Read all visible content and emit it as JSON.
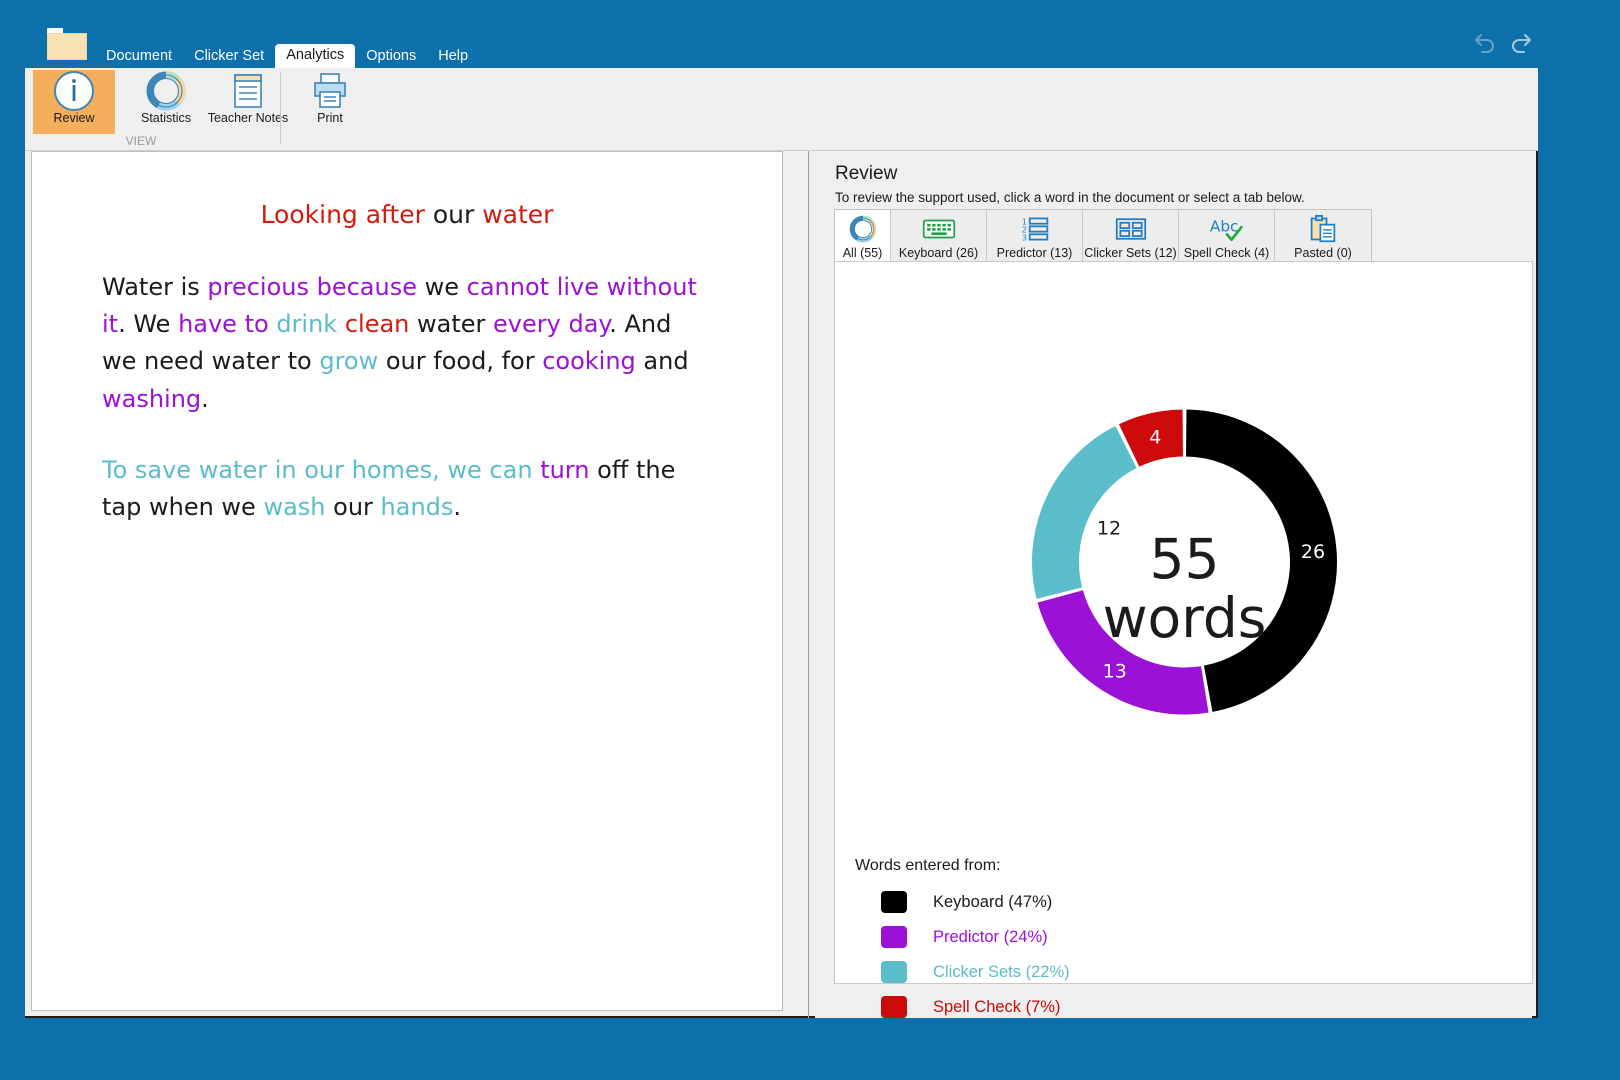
{
  "titlebar": {
    "folder_icon": "folder-icon",
    "menu": [
      {
        "label": "Document",
        "active": false
      },
      {
        "label": "Clicker Set",
        "active": false
      },
      {
        "label": "Analytics",
        "active": true
      },
      {
        "label": "Options",
        "active": false
      },
      {
        "label": "Help",
        "active": false
      }
    ],
    "undo_icon": "undo-arrow-icon",
    "redo_icon": "redo-arrow-icon"
  },
  "ribbon": {
    "group_label": "VIEW",
    "buttons": [
      {
        "label": "Review",
        "icon": "info-circle-icon",
        "selected": true
      },
      {
        "label": "Statistics",
        "icon": "donut-chart-icon",
        "selected": false
      },
      {
        "label": "Teacher Notes",
        "icon": "notes-document-icon",
        "selected": false
      },
      {
        "label": "Print",
        "icon": "printer-icon",
        "selected": false
      }
    ]
  },
  "document": {
    "title_runs": [
      {
        "text": "Looking after ",
        "color": "#d41a0f"
      },
      {
        "text": "our ",
        "color": "#1b1b1b"
      },
      {
        "text": "water",
        "color": "#d41a0f"
      }
    ],
    "paragraphs": [
      [
        {
          "text": "Water is ",
          "color": "#1b1b1b"
        },
        {
          "text": "precious because ",
          "color": "#9b11d6"
        },
        {
          "text": "we ",
          "color": "#1b1b1b"
        },
        {
          "text": "cannot live without it",
          "color": "#9b11d6"
        },
        {
          "text": ".  We ",
          "color": "#1b1b1b"
        },
        {
          "text": "have to ",
          "color": "#9b11d6"
        },
        {
          "text": "drink ",
          "color": "#5bbcca"
        },
        {
          "text": "clean ",
          "color": "#d41a0f"
        },
        {
          "text": "water ",
          "color": "#1b1b1b"
        },
        {
          "text": "every day",
          "color": "#9b11d6"
        },
        {
          "text": ". And we need water to ",
          "color": "#1b1b1b"
        },
        {
          "text": "grow ",
          "color": "#5bbcca"
        },
        {
          "text": "our food, for ",
          "color": "#1b1b1b"
        },
        {
          "text": "cooking ",
          "color": "#9b11d6"
        },
        {
          "text": "and ",
          "color": "#1b1b1b"
        },
        {
          "text": "washing",
          "color": "#9b11d6"
        },
        {
          "text": ".",
          "color": "#1b1b1b"
        }
      ],
      [
        {
          "text": "To save water in our homes, we can ",
          "color": "#5bbcca"
        },
        {
          "text": "turn ",
          "color": "#9b11d6"
        },
        {
          "text": "off the tap when we ",
          "color": "#1b1b1b"
        },
        {
          "text": "wash ",
          "color": "#5bbcca"
        },
        {
          "text": "our ",
          "color": "#1b1b1b"
        },
        {
          "text": "hands",
          "color": "#5bbcca"
        },
        {
          "text": ".",
          "color": "#1b1b1b"
        }
      ]
    ]
  },
  "review": {
    "heading": "Review",
    "subheading": "To review the support used, click a word in the document or select a tab below.",
    "tabs": [
      {
        "label": "All (55)",
        "icon": "donut-chart-icon",
        "selected": true
      },
      {
        "label": "Keyboard (26)",
        "icon": "keyboard-icon",
        "selected": false
      },
      {
        "label": "Predictor (13)",
        "icon": "predictor-list-icon",
        "selected": false
      },
      {
        "label": "Clicker Sets (12)",
        "icon": "grid-cells-icon",
        "selected": false
      },
      {
        "label": "Spell Check (4)",
        "icon": "spellcheck-abc-icon",
        "selected": false
      },
      {
        "label": "Pasted (0)",
        "icon": "clipboard-icon",
        "selected": false
      }
    ],
    "legend_title": "Words entered from:"
  },
  "chart_data": {
    "type": "pie",
    "variant": "donut",
    "title": "",
    "center_line1": "55",
    "center_line2": "words",
    "total": 55,
    "categories": [
      "Keyboard",
      "Predictor",
      "Clicker Sets",
      "Spell Check"
    ],
    "values": [
      26,
      13,
      12,
      4
    ],
    "percents": [
      47,
      24,
      22,
      7
    ],
    "colors": [
      "#000000",
      "#9b11d6",
      "#5bbcca",
      "#cc0a0a"
    ],
    "data_labels": [
      "26",
      "13",
      "12",
      "4"
    ],
    "data_label_colors": [
      "#ffffff",
      "#ffffff",
      "#1b1b1b",
      "#ffffff"
    ],
    "legend_entries": [
      {
        "label": "Keyboard (47%)",
        "color": "#000000",
        "text_color": "#1b1b1b"
      },
      {
        "label": "Predictor (24%)",
        "color": "#9b11d6",
        "text_color": "#9b11d6"
      },
      {
        "label": "Clicker Sets (22%)",
        "color": "#5bbcca",
        "text_color": "#5bbcca"
      },
      {
        "label": "Spell Check (7%)",
        "color": "#cc0a0a",
        "text_color": "#cc0a0a"
      }
    ],
    "legend_position": "bottom-left",
    "grid": false
  }
}
